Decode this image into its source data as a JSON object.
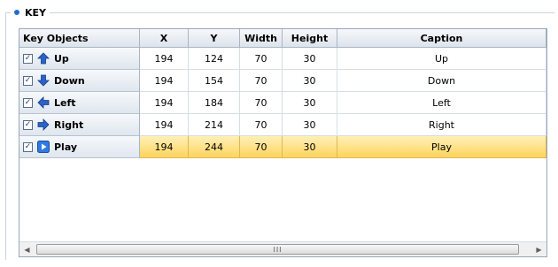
{
  "group": {
    "title": "KEY"
  },
  "grid": {
    "columns": [
      "Key Objects",
      "X",
      "Y",
      "Width",
      "Height",
      "Caption"
    ],
    "rows": [
      {
        "name": "Up",
        "icon": "arrow-up-icon",
        "checked": true,
        "x": "194",
        "y": "124",
        "width": "70",
        "height": "30",
        "caption": "Up",
        "selected": false
      },
      {
        "name": "Down",
        "icon": "arrow-down-icon",
        "checked": true,
        "x": "194",
        "y": "154",
        "width": "70",
        "height": "30",
        "caption": "Down",
        "selected": false
      },
      {
        "name": "Left",
        "icon": "arrow-left-icon",
        "checked": true,
        "x": "194",
        "y": "184",
        "width": "70",
        "height": "30",
        "caption": "Left",
        "selected": false
      },
      {
        "name": "Right",
        "icon": "arrow-right-icon",
        "checked": true,
        "x": "194",
        "y": "214",
        "width": "70",
        "height": "30",
        "caption": "Right",
        "selected": false
      },
      {
        "name": "Play",
        "icon": "play-icon",
        "checked": true,
        "x": "194",
        "y": "244",
        "width": "70",
        "height": "30",
        "caption": "Play",
        "selected": true
      }
    ]
  },
  "scrollbar": {
    "left_arrow": "◀",
    "right_arrow": "▶",
    "grip": "III"
  },
  "colors": {
    "accent": "#1f6fd0",
    "selection": "#ffd45e"
  }
}
